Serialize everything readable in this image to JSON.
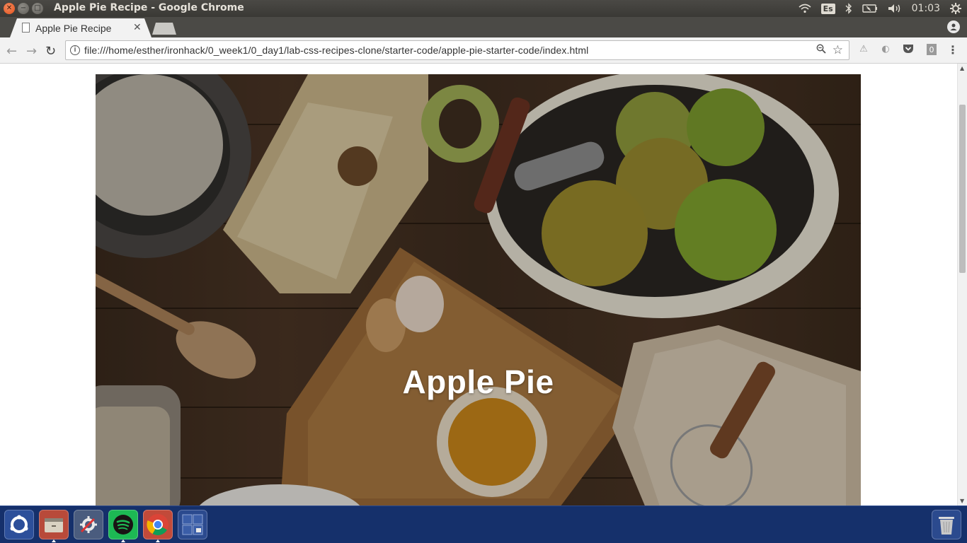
{
  "window": {
    "title": "Apple Pie Recipe - Google Chrome"
  },
  "system_tray": {
    "keyboard_layout": "Es",
    "clock": "01:03"
  },
  "tabs": [
    {
      "label": "Apple Pie Recipe",
      "active": true
    }
  ],
  "toolbar": {
    "url": "file:///home/esther/ironhack/0_week1/0_day1/lab-css-recipes-clone/starter-code/apple-pie-starter-code/index.html"
  },
  "page": {
    "hero_title": "Apple Pie"
  },
  "launcher": {
    "items": [
      "dash-home",
      "files",
      "system-settings",
      "spotify",
      "chrome",
      "workspace-switcher",
      "trash"
    ]
  },
  "colors": {
    "launcher_bg": "#15306b",
    "spotify_green": "#1db954",
    "close_button": "#e2521c"
  }
}
